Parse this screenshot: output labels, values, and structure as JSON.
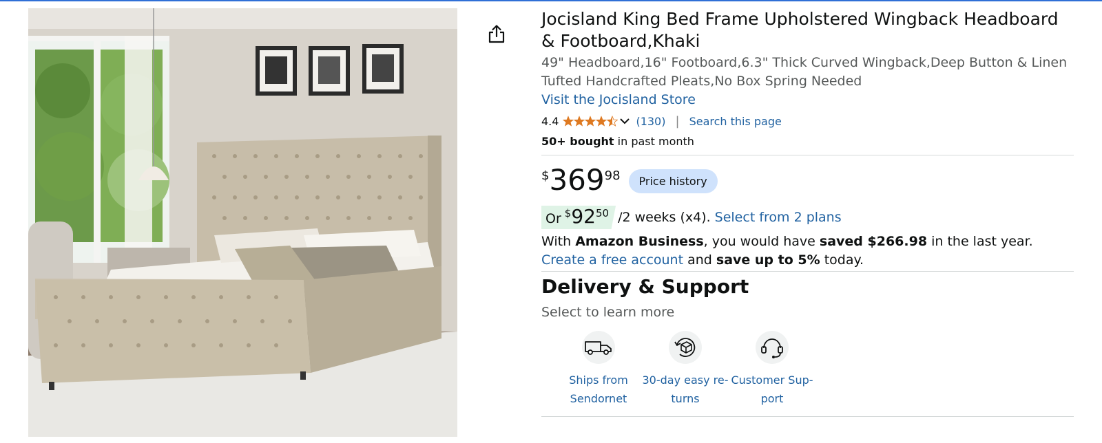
{
  "product": {
    "title": "Jocisland King Bed Frame Upholstered Wingback Headboard & Footboard,Khaki",
    "subtitle": "49\" Headboard,16\" Footboard,6.3\" Thick Curved Wingback,Deep Button & Linen Tufted Handcrafted Pleats,No Box Spring Needed",
    "store_link": "Visit the Jocisland Store",
    "image_alt": "Khaki upholstered king bed with tall tufted wingback headboard in a bright bedroom"
  },
  "rating": {
    "value": "4.4",
    "stars": 4.4,
    "count": "(130)",
    "separator": "|",
    "search_page": "Search this page"
  },
  "bought": {
    "bold": "50+ bought",
    "rest": " in past month"
  },
  "price": {
    "currency": "$",
    "whole": "369",
    "fraction": "98",
    "history_button": "Price history"
  },
  "installment": {
    "or": "Or",
    "currency": "$",
    "whole": "92",
    "fraction": "50",
    "rest": "/2 weeks (x4).",
    "plans_link": "Select from 2 plans"
  },
  "business": {
    "t1": "With ",
    "b1": "Amazon Business",
    "t2": ", you would have ",
    "b2": "saved $266.98",
    "t3": " in the last year. ",
    "link": "Create a free account",
    "t4": " and ",
    "b3": "save up to 5%",
    "t5": " today."
  },
  "delivery": {
    "title": "Delivery & Support",
    "subtitle": "Select to learn more",
    "items": [
      {
        "icon": "truck-icon",
        "label_1": "Ships from",
        "label_2": "Sendornet"
      },
      {
        "icon": "return-box-icon",
        "label_1": "30-day easy re-",
        "label_2": "turns"
      },
      {
        "icon": "headset-icon",
        "label_1": "Customer Sup-",
        "label_2": "port"
      }
    ]
  },
  "colors": {
    "link": "#2162a1",
    "star": "#de7921",
    "price_history_bg": "#cfe2fc",
    "installment_bg": "#dff3e6"
  }
}
